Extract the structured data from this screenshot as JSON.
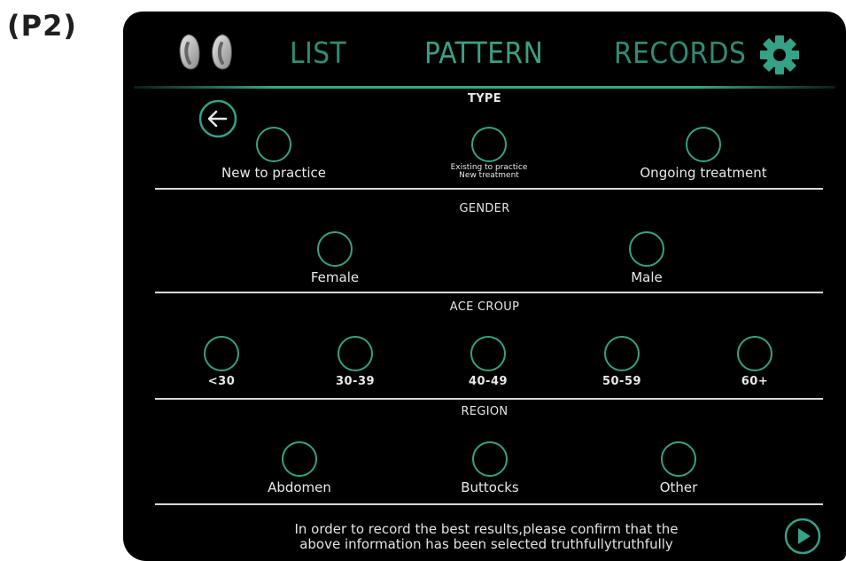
{
  "page_label": "(P2)",
  "nav": {
    "logo_icon": "footprints-logo-icon",
    "tabs": [
      {
        "label": "LIST",
        "active": false
      },
      {
        "label": "PATTERN",
        "active": true
      },
      {
        "label": "RECORDS",
        "active": false
      }
    ],
    "settings_icon": "gear-icon",
    "accent_color": "#35a186"
  },
  "back_icon": "arrow-left-circle-icon",
  "sections": {
    "type": {
      "title": "TYPE",
      "options": [
        {
          "label": "New to practice"
        },
        {
          "label_line1": "Existing to practice",
          "label_line2": "New treatment"
        },
        {
          "label": "Ongoing treatment"
        }
      ]
    },
    "gender": {
      "title": "GENDER",
      "options": [
        {
          "label": "Female"
        },
        {
          "label": "Male"
        }
      ]
    },
    "age_group": {
      "title": "ACE CROUP",
      "options": [
        {
          "label": "<30"
        },
        {
          "label": "30-39"
        },
        {
          "label": "40-49"
        },
        {
          "label": "50-59"
        },
        {
          "label": "60+"
        }
      ]
    },
    "region": {
      "title": "REGION",
      "options": [
        {
          "label": "Abdomen"
        },
        {
          "label": "Buttocks"
        },
        {
          "label": "Other"
        }
      ]
    }
  },
  "footer": {
    "line1": "In order to record the best results,please confirm that the",
    "line2": "above information has been selected truthfullytruthfully",
    "next_icon": "play-circle-icon"
  }
}
